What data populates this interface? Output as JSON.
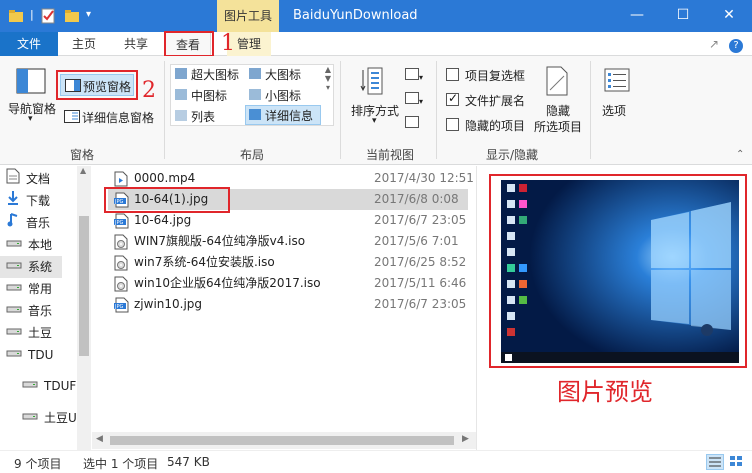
{
  "titlebar": {
    "context_tab": "图片工具",
    "title": "BaiduYunDownload",
    "minimize": "—",
    "maximize": "☐",
    "close": "✕"
  },
  "tabs": {
    "file": "文件",
    "home": "主页",
    "share": "共享",
    "view": "查看",
    "manage": "管理",
    "pin": "↗",
    "help": "?"
  },
  "ribbon": {
    "panes": {
      "nav_pane": "导航窗格",
      "preview_pane": "预览窗格",
      "details_pane": "详细信息窗格",
      "group": "窗格"
    },
    "layout": {
      "extra_large_icons": "超大图标",
      "large_icons": "大图标",
      "medium_icons": "中图标",
      "small_icons": "小图标",
      "list": "列表",
      "details": "详细信息",
      "group": "布局"
    },
    "current_view": {
      "sort_by": "排序方式",
      "group": "当前视图"
    },
    "show_hide": {
      "item_checkboxes": "项目复选框",
      "file_extensions": "文件扩展名",
      "hidden_items": "隐藏的项目",
      "hide_selected_1": "隐藏",
      "hide_selected_2": "所选项目",
      "options": "选项",
      "group": "显示/隐藏",
      "checkbox_item_checked": false,
      "checkbox_ext_checked": true,
      "checkbox_hidden_checked": false
    }
  },
  "annotations": {
    "num1": "1",
    "num2": "2",
    "preview_caption": "图片预览"
  },
  "nav": {
    "items": [
      {
        "label": "文档",
        "icon": "document-icon"
      },
      {
        "label": "下载",
        "icon": "download-icon"
      },
      {
        "label": "音乐",
        "icon": "music-icon"
      },
      {
        "label": "本地",
        "icon": "drive-icon"
      },
      {
        "label": "系统",
        "icon": "drive-icon"
      },
      {
        "label": "常用",
        "icon": "drive-icon"
      },
      {
        "label": "音乐",
        "icon": "drive-icon"
      },
      {
        "label": "土豆",
        "icon": "drive-icon"
      },
      {
        "label": "TDU",
        "icon": "drive-icon"
      },
      {
        "label": "TDUF",
        "icon": "drive-icon"
      },
      {
        "label": "土豆U",
        "icon": "drive-icon"
      }
    ]
  },
  "files": [
    {
      "name": "0000.mp4",
      "date": "2017/4/30 12:51",
      "type": "video"
    },
    {
      "name": "10-64(1).jpg",
      "date": "2017/6/8 0:08",
      "type": "jpg"
    },
    {
      "name": "10-64.jpg",
      "date": "2017/6/7 23:05",
      "type": "jpg"
    },
    {
      "name": "WIN7旗舰版-64位纯净版v4.iso",
      "date": "2017/5/6 7:01",
      "type": "iso"
    },
    {
      "name": "win7系统-64位安装版.iso",
      "date": "2017/6/25 8:52",
      "type": "iso"
    },
    {
      "name": "win10企业版64位纯净版2017.iso",
      "date": "2017/5/11 6:46",
      "type": "iso"
    },
    {
      "name": "zjwin10.jpg",
      "date": "2017/6/7 23:05",
      "type": "jpg"
    }
  ],
  "status": {
    "count": "9 个项目",
    "selected": "选中 1 个项目",
    "size": "547 KB"
  },
  "colors": {
    "titlebar": "#2b79d6",
    "accent_red": "#e0262b",
    "selected_row": "#d9d9d9"
  }
}
